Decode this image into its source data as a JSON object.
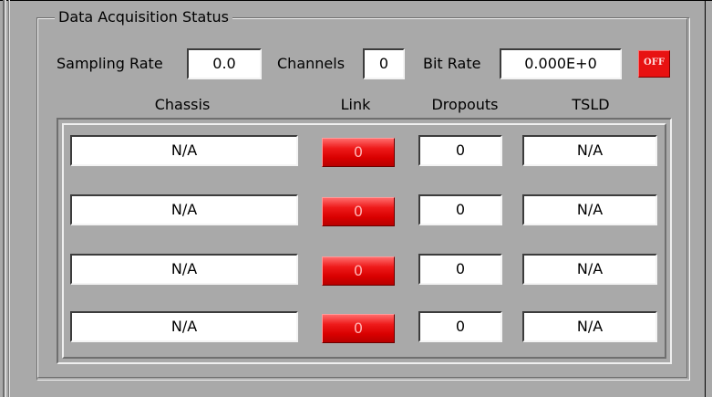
{
  "group": {
    "title": "Data Acquisition Status"
  },
  "status": {
    "sampling_rate_label": "Sampling Rate",
    "sampling_rate_value": "0.0",
    "channels_label": "Channels",
    "channels_value": "0",
    "bit_rate_label": "Bit Rate",
    "bit_rate_value": "0.000E+0",
    "indicator_label": "OFF",
    "indicator_color": "#e81212"
  },
  "columns": {
    "chassis": "Chassis",
    "link": "Link",
    "dropouts": "Dropouts",
    "tsld": "TSLD"
  },
  "rows": [
    {
      "chassis": "N/A",
      "link": "0",
      "dropouts": "0",
      "tsld": "N/A"
    },
    {
      "chassis": "N/A",
      "link": "0",
      "dropouts": "0",
      "tsld": "N/A"
    },
    {
      "chassis": "N/A",
      "link": "0",
      "dropouts": "0",
      "tsld": "N/A"
    },
    {
      "chassis": "N/A",
      "link": "0",
      "dropouts": "0",
      "tsld": "N/A"
    }
  ],
  "colors": {
    "background": "#a9a9a9",
    "led_red": "#e81212"
  }
}
